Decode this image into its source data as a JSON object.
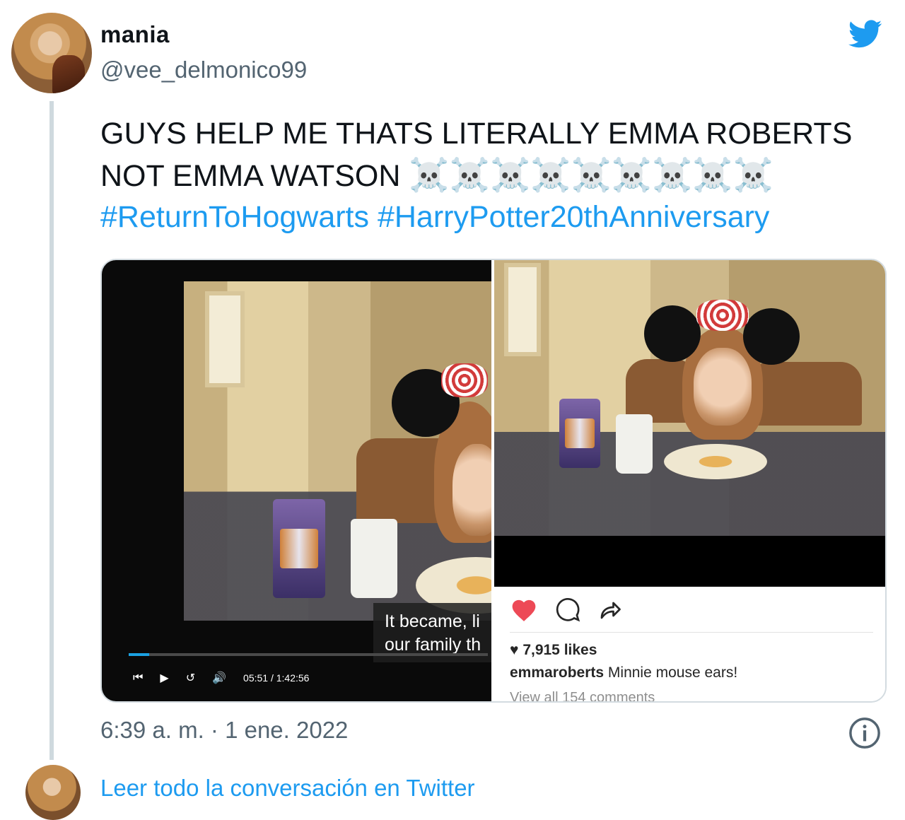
{
  "user": {
    "display_name": "mania",
    "handle": "@vee_delmonico99",
    "avatar": "avatar"
  },
  "brand": {
    "icon": "twitter-bird-icon",
    "color": "#1d9bf0"
  },
  "tweet": {
    "line1": "GUYS HELP ME THATS LITERALLY EMMA ROBERTS",
    "line2": "NOT EMMA WATSON",
    "emoji": "☠️☠️☠️☠️☠️☠️☠️☠️☠️",
    "hashtag1": "#ReturnToHogwarts",
    "hashtag2": "#HarryPotter20thAnniversary"
  },
  "media": {
    "video": {
      "caption_line1": "It became, li",
      "caption_line2": "our family th",
      "time": "05:51 / 1:42:56",
      "progress": 0.057
    },
    "instagram": {
      "likes": "7,915 likes",
      "caption_user": "emmaroberts",
      "caption_text": "Minnie mouse ears!",
      "view_comments": "View all 154 comments"
    }
  },
  "footer": {
    "timestamp": "6:39 a. m. · 1 ene. 2022",
    "info_icon": "info-icon",
    "read_more": "Leer todo la conversación en Twitter"
  }
}
